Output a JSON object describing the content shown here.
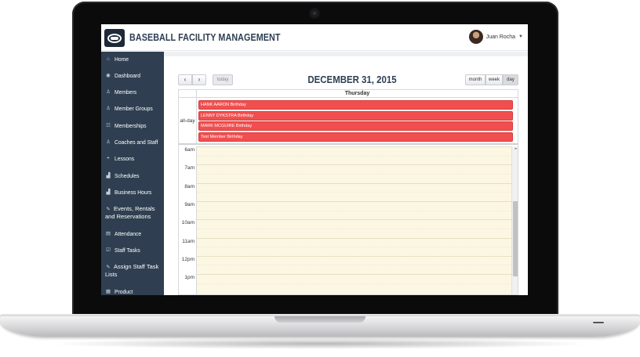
{
  "app": {
    "title": "BASEBALL FACILITY MANAGEMENT",
    "user_name": "Juan Rocha"
  },
  "sidebar": {
    "items": [
      {
        "label": "Home",
        "icon": "home-icon"
      },
      {
        "label": "Dashboard",
        "icon": "eye-icon"
      },
      {
        "label": "Members",
        "icon": "user-icon"
      },
      {
        "label": "Member Groups",
        "icon": "users-icon"
      },
      {
        "label": "Memberships",
        "icon": "group-icon"
      },
      {
        "label": "Coaches and Staff",
        "icon": "user-outline-icon"
      },
      {
        "label": "Lessons",
        "icon": "cap-icon"
      },
      {
        "label": "Schedules",
        "icon": "chart-icon"
      },
      {
        "label": "Business Hours",
        "icon": "chart-icon"
      },
      {
        "label": "Events, Rentals and Reservations",
        "icon": "ticket-icon"
      },
      {
        "label": "Attendance",
        "icon": "list-icon"
      },
      {
        "label": "Staff Tasks",
        "icon": "tasks-icon"
      },
      {
        "label": "Assign Staff Task Lists",
        "icon": "pencil-icon"
      },
      {
        "label": "Product",
        "icon": "box-icon"
      }
    ]
  },
  "calendar": {
    "title": "DECEMBER 31, 2015",
    "today_label": "today",
    "prev_label": "‹",
    "next_label": "›",
    "views": {
      "month": "month",
      "week": "week",
      "day": "day"
    },
    "active_view": "day",
    "day_header": "Thursday",
    "allday_label": "all-day",
    "events": [
      "HANK AARON Birthday",
      "LENNY DYKSTRA Birthday",
      "MARK MCGUIRE Birthday",
      "Test Member Birthday"
    ],
    "time_labels": [
      "6am",
      "7am",
      "8am",
      "9am",
      "10am",
      "11am",
      "12pm",
      "1pm"
    ],
    "event_color": "#f14f4f",
    "slot_color": "#fcf7e3"
  },
  "colors": {
    "sidebar_bg": "#2f3f51",
    "brand": "#2e3f53"
  }
}
